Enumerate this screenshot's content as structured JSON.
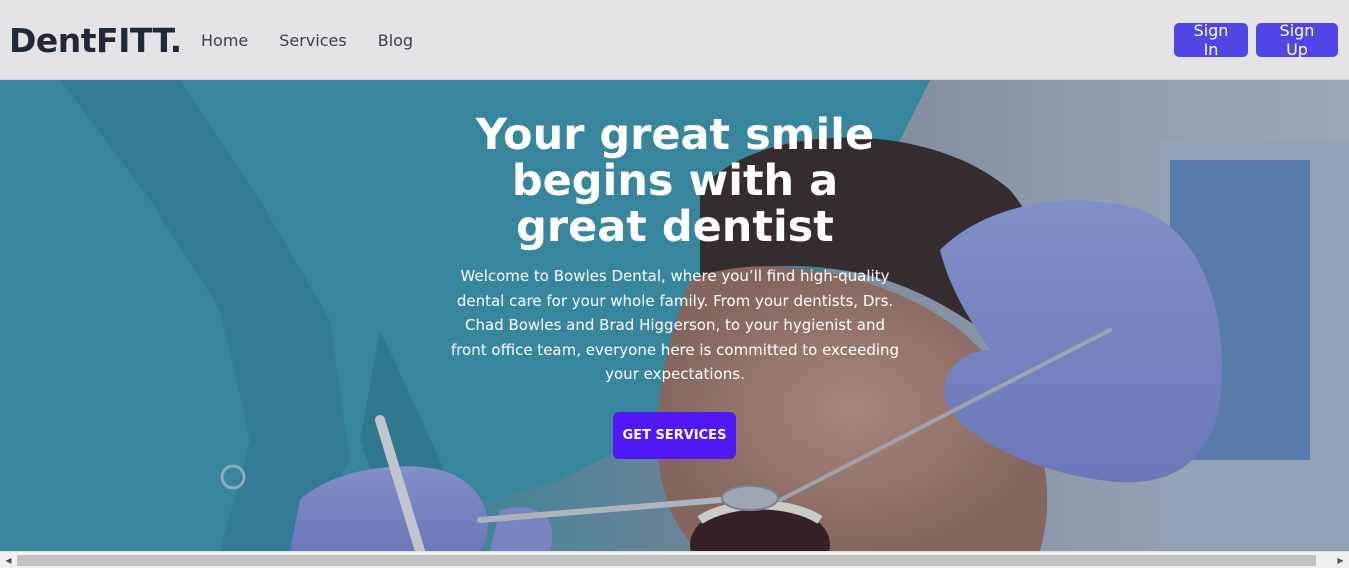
{
  "navbar": {
    "brand": "DentFITT.",
    "links": [
      "Home",
      "Services",
      "Blog"
    ],
    "signin_label": "Sign In",
    "signup_label": "Sign Up"
  },
  "hero": {
    "title": "Your great smile begins with a great dentist",
    "text": "Welcome to Bowles Dental, where you’ll find high-quality dental care for your whole family. From your dentists, Drs. Chad Bowles and Brad Higgerson, to your hygienist and front office team, everyone here is committed to exceeding your expectations.",
    "cta_label": "GET SERVICES"
  },
  "scrollbar": {
    "left_arrow_icon": "chevron-left-icon",
    "right_arrow_icon": "chevron-right-icon"
  },
  "colors": {
    "accent": "#4f46e5",
    "cta": "#4f18f5",
    "navbar_bg": "#e4e4e7",
    "brand_text": "#1f2937"
  }
}
